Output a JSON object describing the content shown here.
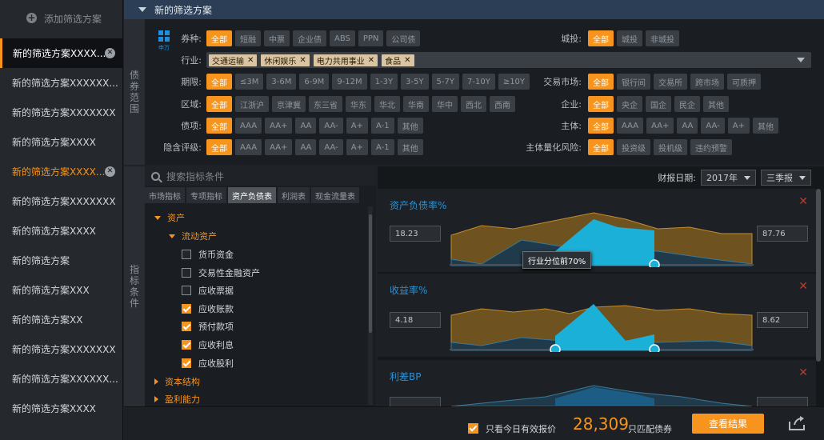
{
  "sidebar": {
    "add_label": "添加筛选方案",
    "items": [
      {
        "label": "新的筛选方案XXXX...",
        "active": true
      },
      {
        "label": "新的筛选方案XXXXXX..."
      },
      {
        "label": "新的筛选方案XXXXXXX"
      },
      {
        "label": "新的筛选方案XXXX"
      },
      {
        "label": "新的筛选方案XXXX...",
        "highlight": true
      },
      {
        "label": "新的筛选方案XXXXXXX"
      },
      {
        "label": "新的筛选方案XXXX"
      },
      {
        "label": "新的筛选方案"
      },
      {
        "label": "新的筛选方案XXX"
      },
      {
        "label": "新的筛选方案XX"
      },
      {
        "label": "新的筛选方案XXXXXXX"
      },
      {
        "label": "新的筛选方案XXXXXX..."
      },
      {
        "label": "新的筛选方案XXXX"
      }
    ]
  },
  "header": {
    "title": "新的筛选方案"
  },
  "bond_scope": {
    "vlabel": [
      "债",
      "券",
      "范",
      "围"
    ],
    "logo_text": "申万",
    "bond_type": {
      "label": "券种:",
      "options": [
        "全部",
        "短融",
        "中票",
        "企业债",
        "ABS",
        "PPN",
        "公司债"
      ]
    },
    "chengtou": {
      "label": "城投:",
      "options": [
        "全部",
        "城投",
        "非城投"
      ]
    },
    "industry": {
      "label": "行业:",
      "tags": [
        "交通运输",
        "休闲娱乐",
        "电力共用事业",
        "食品"
      ],
      "remove_glyph": "✕"
    },
    "term": {
      "label": "期限:",
      "options": [
        "全部",
        "≤3M",
        "3-6M",
        "6-9M",
        "9-12M",
        "1-3Y",
        "3-5Y",
        "5-7Y",
        "7-10Y",
        "≥10Y"
      ]
    },
    "market": {
      "label": "交易市场:",
      "options": [
        "全部",
        "银行间",
        "交易所",
        "跨市场",
        "可质押"
      ]
    },
    "region": {
      "label": "区域:",
      "options": [
        "全部",
        "江浙沪",
        "京津冀",
        "东三省",
        "华东",
        "华北",
        "华南",
        "华中",
        "西北",
        "西南"
      ]
    },
    "enterprise": {
      "label": "企业:",
      "options": [
        "全部",
        "央企",
        "国企",
        "民企",
        "其他"
      ]
    },
    "bond_rating": {
      "label": "债项:",
      "options": [
        "全部",
        "AAA",
        "AA+",
        "AA",
        "AA-",
        "A+",
        "A-1",
        "其他"
      ]
    },
    "issuer_rating": {
      "label": "主体:",
      "options": [
        "全部",
        "AAA",
        "AA+",
        "AA",
        "AA-",
        "A+",
        "其他"
      ]
    },
    "implied_rating": {
      "label": "隐含评级:",
      "options": [
        "全部",
        "AAA",
        "AA+",
        "AA",
        "AA-",
        "A+",
        "A-1",
        "其他"
      ]
    },
    "issuer_risk": {
      "label": "主体量化风险:",
      "options": [
        "全部",
        "投资级",
        "投机级",
        "违约预警"
      ]
    }
  },
  "indicator": {
    "vlabel": [
      "指",
      "标",
      "条",
      "件"
    ],
    "search_placeholder": "搜索指标条件",
    "tabs": [
      "市场指标",
      "专项指标",
      "资产负债表",
      "利润表",
      "现金流量表"
    ],
    "active_tab": 2,
    "tree": {
      "root": "资产",
      "sub": "流动资产",
      "items": [
        {
          "label": "货币资金",
          "checked": false
        },
        {
          "label": "交易性金融资产",
          "checked": false
        },
        {
          "label": "应收票据",
          "checked": false
        },
        {
          "label": "应收账款",
          "checked": true
        },
        {
          "label": "预付款项",
          "checked": true
        },
        {
          "label": "应收利息",
          "checked": true
        },
        {
          "label": "应收股利",
          "checked": true
        }
      ],
      "collapsed": [
        "资本结构",
        "盈利能力"
      ]
    }
  },
  "report": {
    "label": "财报日期:",
    "year": "2017年",
    "season": "三季报"
  },
  "cards": [
    {
      "title": "资产负债率%",
      "min": "18.23",
      "max": "87.76",
      "tooltip": "行业分位前70%",
      "close": "✕"
    },
    {
      "title": "收益率%",
      "min": "4.18",
      "max": "8.62",
      "close": "✕"
    },
    {
      "title": "利差BP",
      "close": "✕"
    }
  ],
  "bottom": {
    "only_today_label": "只看今日有效报价",
    "count": "28,309",
    "count_suffix": "只匹配债券",
    "view_button": "查看结果"
  },
  "colors": {
    "accent": "#f7941d",
    "blue": "#1ab0d8",
    "brown": "#7a5a22"
  }
}
